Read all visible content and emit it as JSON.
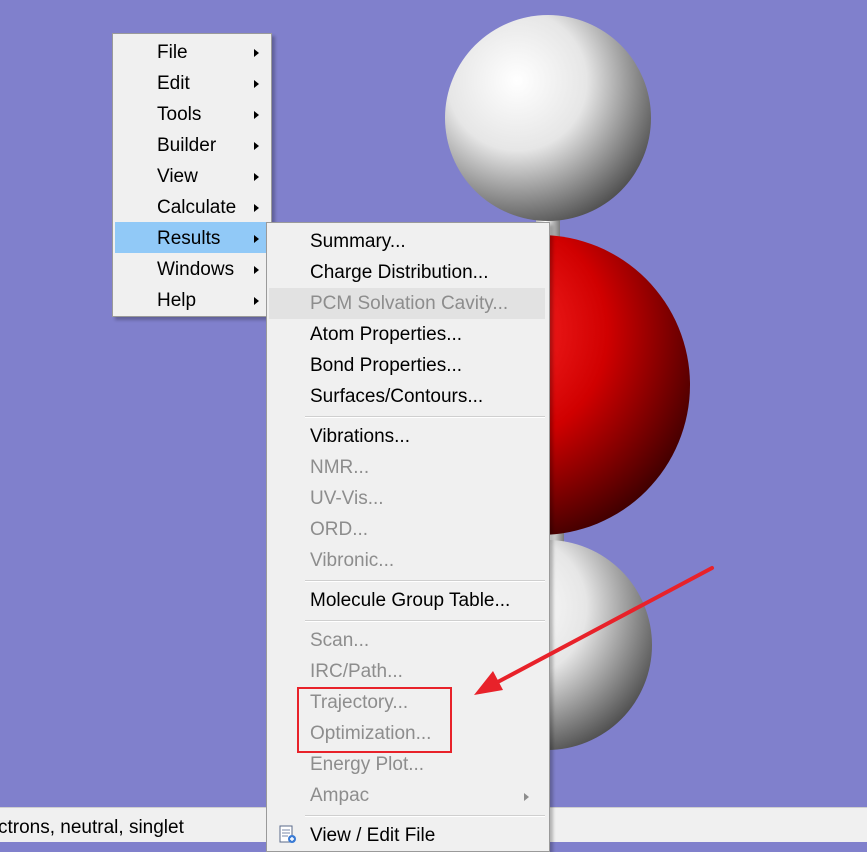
{
  "status_bar": {
    "text": "ctrons, neutral, singlet"
  },
  "main_menu": {
    "items": [
      {
        "label": "File"
      },
      {
        "label": "Edit"
      },
      {
        "label": "Tools"
      },
      {
        "label": "Builder"
      },
      {
        "label": "View"
      },
      {
        "label": "Calculate"
      },
      {
        "label": "Results",
        "active": true
      },
      {
        "label": "Windows"
      },
      {
        "label": "Help"
      }
    ]
  },
  "results_menu": {
    "items": [
      {
        "label": "Summary...",
        "enabled": true
      },
      {
        "label": "Charge Distribution...",
        "enabled": true
      },
      {
        "label": "PCM Solvation Cavity...",
        "enabled": false
      },
      {
        "label": "Atom Properties...",
        "enabled": true
      },
      {
        "label": "Bond Properties...",
        "enabled": true
      },
      {
        "label": "Surfaces/Contours...",
        "enabled": true
      },
      {
        "label": "Vibrations...",
        "enabled": true
      },
      {
        "label": "NMR...",
        "enabled": false
      },
      {
        "label": "UV-Vis...",
        "enabled": false
      },
      {
        "label": "ORD...",
        "enabled": false
      },
      {
        "label": "Vibronic...",
        "enabled": false
      },
      {
        "label": "Molecule Group Table...",
        "enabled": true
      },
      {
        "label": "Scan...",
        "enabled": false
      },
      {
        "label": "IRC/Path...",
        "enabled": false
      },
      {
        "label": "Trajectory...",
        "enabled": false
      },
      {
        "label": "Optimization...",
        "enabled": false
      },
      {
        "label": "Energy Plot...",
        "enabled": false
      },
      {
        "label": "Ampac",
        "enabled": false
      },
      {
        "label": "View / Edit File",
        "enabled": true
      }
    ]
  },
  "colors": {
    "background": "#8080cc",
    "menu_bg": "#f0f0f0",
    "menu_active": "#91c9f7",
    "disabled_text": "#8d8d8d",
    "annotation": "#e8222a",
    "hydrogen": "#ffffff",
    "oxygen": "#ff0000"
  }
}
